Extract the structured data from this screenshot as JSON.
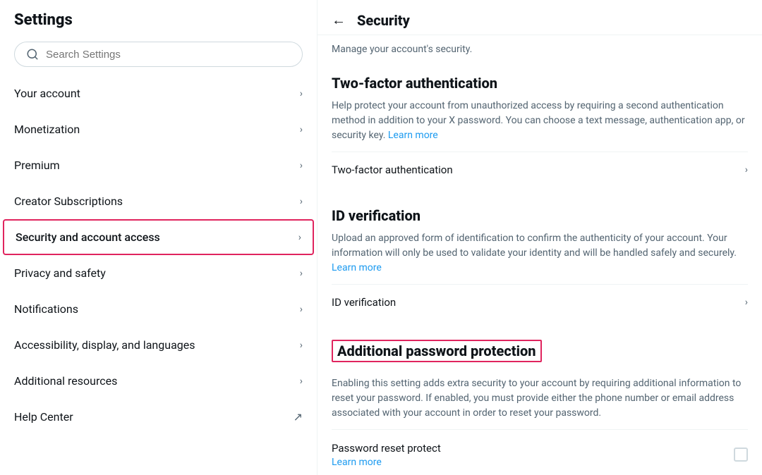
{
  "sidebar": {
    "title": "Settings",
    "search": {
      "placeholder": "Search Settings"
    },
    "nav_items": [
      {
        "id": "your-account",
        "label": "Your account",
        "type": "chevron",
        "active": false
      },
      {
        "id": "monetization",
        "label": "Monetization",
        "type": "chevron",
        "active": false
      },
      {
        "id": "premium",
        "label": "Premium",
        "type": "chevron",
        "active": false
      },
      {
        "id": "creator-subscriptions",
        "label": "Creator Subscriptions",
        "type": "chevron",
        "active": false
      },
      {
        "id": "security-and-account-access",
        "label": "Security and account access",
        "type": "chevron",
        "active": true
      },
      {
        "id": "privacy-and-safety",
        "label": "Privacy and safety",
        "type": "chevron",
        "active": false
      },
      {
        "id": "notifications",
        "label": "Notifications",
        "type": "chevron",
        "active": false
      },
      {
        "id": "accessibility-display-languages",
        "label": "Accessibility, display, and languages",
        "type": "chevron",
        "active": false
      },
      {
        "id": "additional-resources",
        "label": "Additional resources",
        "type": "chevron",
        "active": false
      },
      {
        "id": "help-center",
        "label": "Help Center",
        "type": "external",
        "active": false
      }
    ]
  },
  "content": {
    "back_label": "←",
    "title": "Security",
    "subtitle": "Manage your account's security.",
    "sections": [
      {
        "id": "two-factor-auth",
        "heading": "Two-factor authentication",
        "highlighted": false,
        "description": "Help protect your account from unauthorized access by requiring a second authentication method in addition to your X password. You can choose a text message, authentication app, or security key.",
        "learn_more_label": "Learn more",
        "items": [
          {
            "id": "two-factor-auth-item",
            "label": "Two-factor authentication"
          }
        ]
      },
      {
        "id": "id-verification",
        "heading": "ID verification",
        "highlighted": false,
        "description": "Upload an approved form of identification to confirm the authenticity of your account. Your information will only be used to validate your identity and will be handled safely and securely.",
        "learn_more_label": "Learn more",
        "items": [
          {
            "id": "id-verification-item",
            "label": "ID verification"
          }
        ]
      },
      {
        "id": "additional-password-protection",
        "heading": "Additional password protection",
        "highlighted": true,
        "description": "Enabling this setting adds extra security to your account by requiring additional information to reset your password. If enabled, you must provide either the phone number or email address associated with your account in order to reset your password.",
        "learn_more_label": "Learn more",
        "password_reset_label": "Password reset protect"
      }
    ]
  }
}
